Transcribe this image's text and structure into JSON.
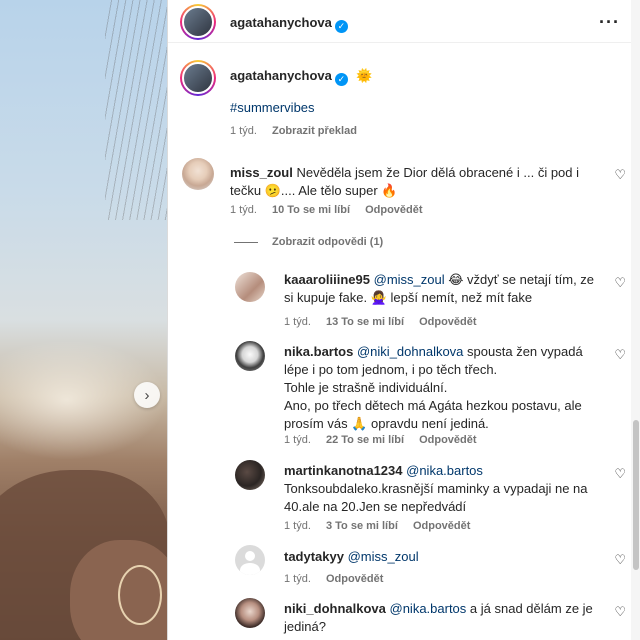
{
  "post": {
    "author": "agatahanychova",
    "more_icon": "more-horizontal-icon",
    "caption_hashtag": "#summervibes",
    "caption_time": "1 týd.",
    "translate_label": "Zobrazit překlad",
    "sun_emoji": "🌞"
  },
  "view_replies_label": "Zobrazit odpovědi (1)",
  "comments": [
    {
      "username": "miss_zoul",
      "mention": "",
      "lines": [
        "Nevěděla jsem že Dior dělá obracené i ... či pod i",
        "tečku 🫤.... Ale tělo super 🔥"
      ],
      "time": "1 týd.",
      "likes": "10 To se mi líbí",
      "reply": "Odpovědět"
    },
    {
      "username": "kaaaroliiine95",
      "mention": "@miss_zoul",
      "lines": [
        "😂 vždyť se netají tím, ze",
        "si kupuje fake. 🙅‍♀️ lepší nemít, než mít fake"
      ],
      "time": "1 týd.",
      "likes": "13 To se mi líbí",
      "reply": "Odpovědět"
    },
    {
      "username": "nika.bartos",
      "mention": "@niki_dohnalkova",
      "lines": [
        "spousta žen vypadá",
        "lépe i po tom jednom, i po těch třech.",
        "Tohle je strašně individuální.",
        "Ano, po třech dětech má Agáta hezkou postavu, ale",
        "prosím vás 🙏 opravdu není jediná."
      ],
      "time": "1 týd.",
      "likes": "22 To se mi líbí",
      "reply": "Odpovědět"
    },
    {
      "username": "martinkanotna1234",
      "mention": "@nika.bartos",
      "lines": [
        "",
        "Tonksoubdaleko.krasnější maminky a vypadaji ne na",
        "40.ale na 20.Jen se nepředvádí"
      ],
      "time": "1 týd.",
      "likes": "3 To se mi líbí",
      "reply": "Odpovědět"
    },
    {
      "username": "tadytakyy",
      "mention": "@miss_zoul",
      "lines": [
        ""
      ],
      "time": "1 týd.",
      "likes": "",
      "reply": "Odpovědět"
    },
    {
      "username": "niki_dohnalkova",
      "mention": "@nika.bartos",
      "lines": [
        "a já snad dělám ze je",
        "jediná?"
      ],
      "time": "",
      "likes": "",
      "reply": ""
    }
  ],
  "icons": {
    "heart": "heart-outline-icon",
    "verified": "verified-badge-icon",
    "next": "chevron-right-icon"
  },
  "colors": {
    "link": "#00376b",
    "verified": "#0095f6",
    "meta": "#737373"
  }
}
